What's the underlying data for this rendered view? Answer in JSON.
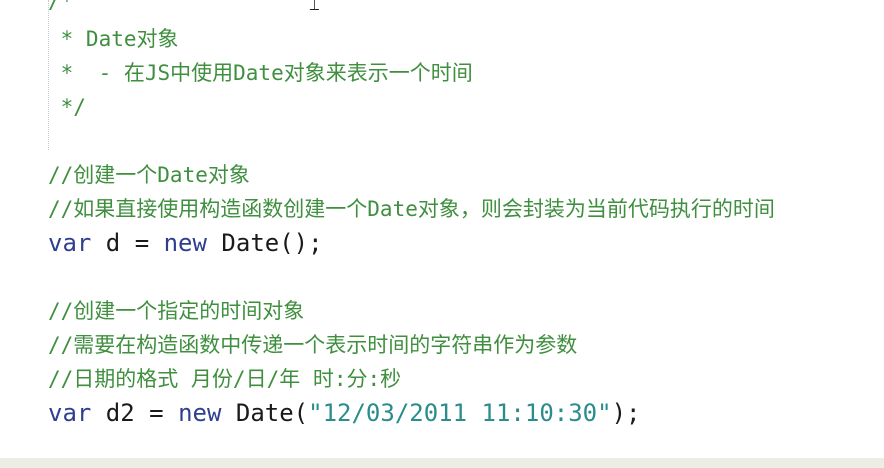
{
  "editor": {
    "block_comment": {
      "open": "/*",
      "line1": " * Date对象",
      "line2": " *  - 在JS中使用Date对象来表示一个时间",
      "close": " */"
    },
    "section1": {
      "comment1": "//创建一个Date对象",
      "comment2": "//如果直接使用构造函数创建一个Date对象，则会封装为当前代码执行的时间",
      "code": {
        "kw_var": "var",
        "mid": " d = ",
        "kw_new": "new",
        "tail": " Date();"
      }
    },
    "section2": {
      "comment1": "//创建一个指定的时间对象",
      "comment2": "//需要在构造函数中传递一个表示时间的字符串作为参数",
      "comment3": "//日期的格式 月份/日/年 时:分:秒",
      "code": {
        "kw_var": "var",
        "mid": " d2 = ",
        "kw_new": "new",
        "call_open": " Date(",
        "string": "\"12/03/2011 11:10:30\"",
        "call_close": ");"
      }
    }
  },
  "colors": {
    "comment": "#3f8f3f",
    "keyword": "#2f3f8f",
    "string": "#2a8c8c",
    "text": "#1a1a1a"
  }
}
